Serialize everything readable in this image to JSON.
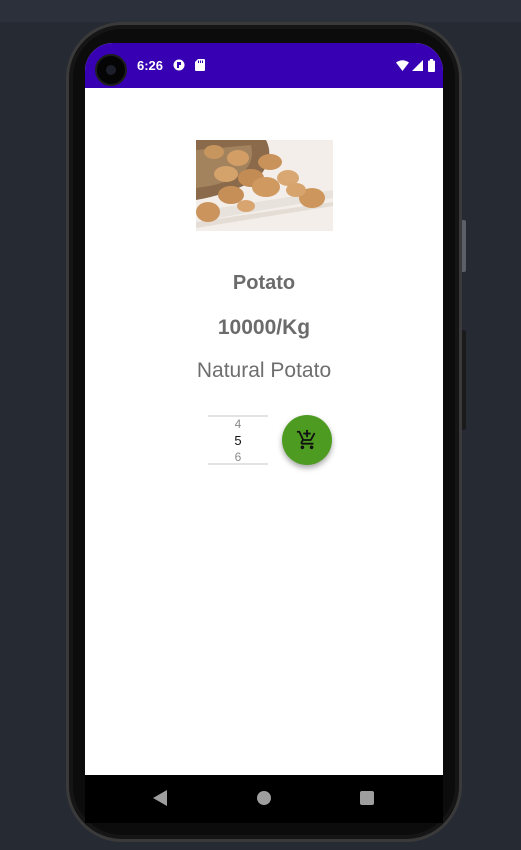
{
  "status_bar": {
    "time": "6:26",
    "background_color": "#3700b3",
    "icons": [
      "notification-icon",
      "sd-card-icon",
      "wifi-icon",
      "signal-icon",
      "battery-icon"
    ]
  },
  "product": {
    "image_icon": "potato-image",
    "title": "Potato",
    "price": "10000/Kg",
    "description": "Natural Potato"
  },
  "quantity_picker": {
    "prev_value": "4",
    "current_value": "5",
    "next_value": "6"
  },
  "add_to_cart": {
    "icon": "add-shopping-cart-icon",
    "color": "#4e9b22"
  },
  "navigation": {
    "icons": [
      "back-icon",
      "home-icon",
      "recents-icon"
    ]
  }
}
